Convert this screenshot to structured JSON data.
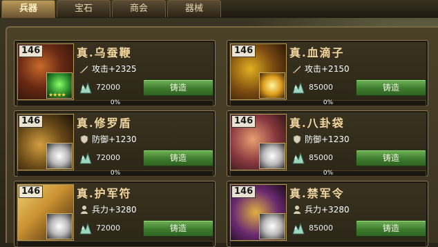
{
  "tabs": [
    {
      "label": "兵器",
      "active": true
    },
    {
      "label": "宝石",
      "active": false
    },
    {
      "label": "商会",
      "active": false
    },
    {
      "label": "器械",
      "active": false
    }
  ],
  "colors": {
    "forge_button": "#3e7c2e",
    "name_text": "#f2d7a0",
    "card_border": "#8b7a52"
  },
  "items": [
    {
      "level": "146",
      "name": "真.乌蚕鞭",
      "stat_icon": "sword-icon",
      "stat": "攻击+2325",
      "cost": "72000",
      "button": "铸造",
      "progress_label": "0%",
      "progress": 0,
      "gem": "green-jade-icon",
      "stars": "★★★★"
    },
    {
      "level": "146",
      "name": "真.血滴子",
      "stat_icon": "sword-icon",
      "stat": "攻击+2150",
      "cost": "85000",
      "button": "铸造",
      "progress_label": "0%",
      "progress": 0,
      "gem": "gold-crystal-icon",
      "stars": ""
    },
    {
      "level": "146",
      "name": "真.修罗盾",
      "stat_icon": "shield-icon",
      "stat": "防御+1230",
      "cost": "72000",
      "button": "铸造",
      "progress_label": "0%",
      "progress": 0,
      "gem": "white-crystal-icon",
      "stars": ""
    },
    {
      "level": "146",
      "name": "真.八卦袋",
      "stat_icon": "shield-icon",
      "stat": "防御+1230",
      "cost": "85000",
      "button": "铸造",
      "progress_label": "0%",
      "progress": 0,
      "gem": "white-crystal-icon",
      "stars": ""
    },
    {
      "level": "146",
      "name": "真.护军符",
      "stat_icon": "soldier-icon",
      "stat": "兵力+3280",
      "cost": "72000",
      "button": "铸造",
      "progress_label": "",
      "progress": 0,
      "gem": "white-crystal-icon",
      "stars": ""
    },
    {
      "level": "146",
      "name": "真.禁军令",
      "stat_icon": "soldier-icon",
      "stat": "兵力+3280",
      "cost": "85000",
      "button": "铸造",
      "progress_label": "",
      "progress": 0,
      "gem": "white-crystal-icon",
      "stars": ""
    }
  ]
}
